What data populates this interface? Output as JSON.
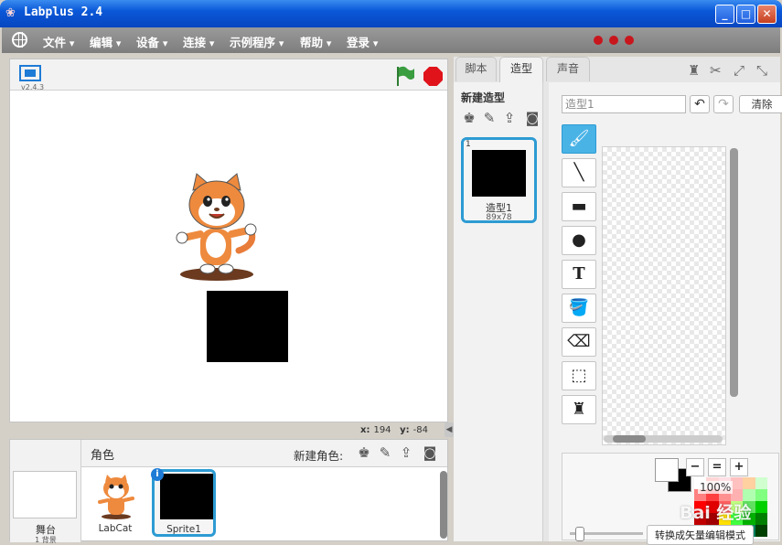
{
  "window": {
    "title": "Labplus 2.4",
    "minimize": "_",
    "maximize": "□",
    "close": "✕"
  },
  "menu": {
    "items": [
      "文件",
      "编辑",
      "设备",
      "连接",
      "示例程序",
      "帮助",
      "登录"
    ]
  },
  "stage": {
    "version": "v2.4.3",
    "coords": {
      "x_label": "x:",
      "x": "194",
      "y_label": "y:",
      "y": "-84"
    },
    "collapse": "◀"
  },
  "sprites": {
    "title": "角色",
    "new_sprite_label": "新建角色:",
    "stage_label": "舞台",
    "stage_sub": "1 背景",
    "items": [
      {
        "label": "LabCat"
      },
      {
        "label": "Sprite1",
        "info": "i"
      }
    ]
  },
  "tabs": [
    "脚本",
    "造型",
    "声音"
  ],
  "costumes": {
    "new_costume": "新建造型",
    "items": [
      {
        "num": "1",
        "name": "造型1",
        "size": "89x78"
      }
    ]
  },
  "editor": {
    "costume_name": "造型1",
    "undo": "↶",
    "redo": "↷",
    "clear": "清除",
    "zoom_level": "100%",
    "zoom_out": "−",
    "zoom_reset": "=",
    "zoom_in": "+",
    "mode_button": "转换成矢量编辑模式",
    "tools": [
      "brush-tool",
      "line-tool",
      "rectangle-tool",
      "ellipse-tool",
      "text-tool",
      "fill-tool",
      "eraser-tool",
      "select-tool",
      "stamp-tool"
    ],
    "tool_glyphs": [
      "🖌",
      "╲",
      "▬",
      "●",
      "T",
      "🪣",
      "⌫",
      "⬚",
      "♜"
    ]
  },
  "colors": {
    "accent": "#2d9bd3",
    "stop": "#e0131b",
    "flag": "#2e7d32",
    "swatches": [
      "#ffffff",
      "#ffd6d6",
      "#ffe0e6",
      "#ffc0c0",
      "#ffd0a0",
      "#d0ffd0",
      "#ff8080",
      "#ff4040",
      "#ff9090",
      "#ffb0b0",
      "#b0ffb0",
      "#80ff80",
      "#ff0000",
      "#e00000",
      "#ff6060",
      "#c0ff80",
      "#60e060",
      "#00d000",
      "#c00000",
      "#a00000",
      "#ffe000",
      "#40ff40",
      "#00b000",
      "#008000",
      "#ffff00",
      "#c0c000",
      "#00ff80",
      "#00c060",
      "#008060",
      "#004000"
    ]
  },
  "watermark": "Bai 经验"
}
